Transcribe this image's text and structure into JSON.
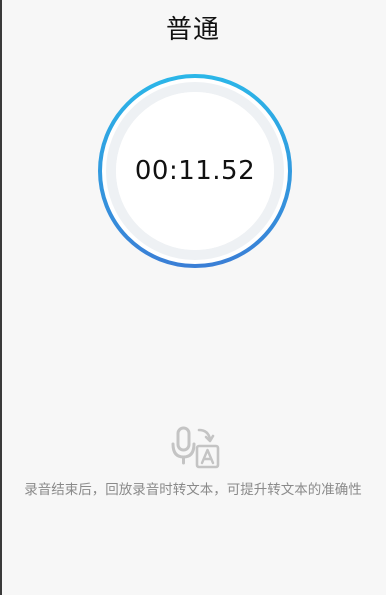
{
  "header": {
    "title": "普通"
  },
  "recorder": {
    "elapsed": "00:11.52",
    "ring_color_start": "#2bb6e8",
    "ring_color_end": "#3a7fd6",
    "inner_fill": "#ffffff",
    "track_color": "#e9edf1"
  },
  "hint": {
    "icon": "mic-transcribe-icon",
    "text": "录音结束后，回放录音时转文本，可提升转文本的准确性"
  }
}
